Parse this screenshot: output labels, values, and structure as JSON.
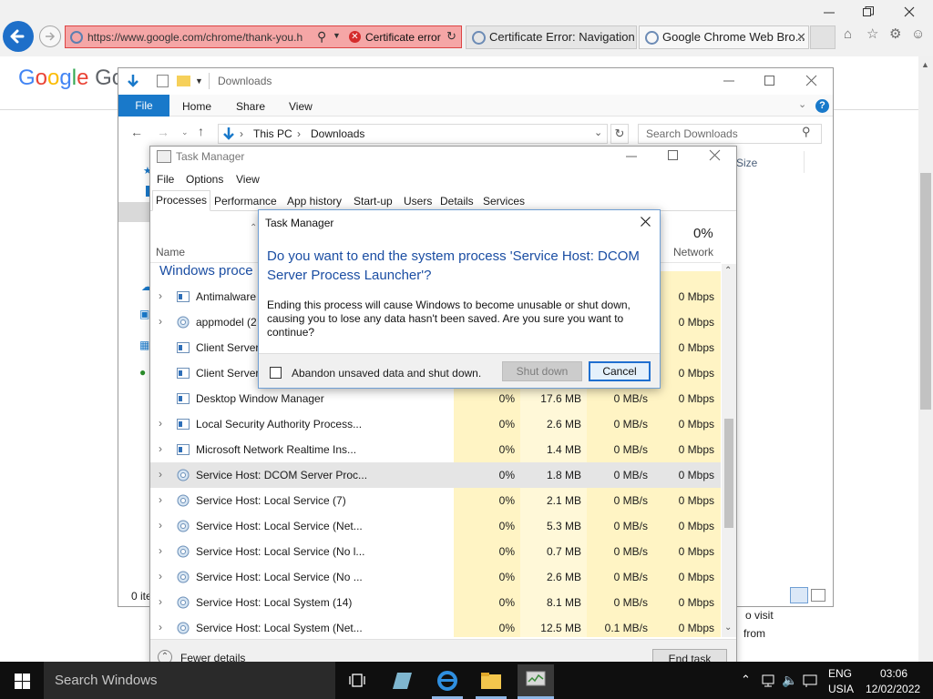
{
  "browser": {
    "address_url": "https://www.google.com/chrome/thank-you.h",
    "cert_error": "Certificate error",
    "tabs": [
      {
        "label": "Certificate Error: Navigation ..."
      },
      {
        "label": "Google Chrome Web Bro..."
      }
    ]
  },
  "page": {
    "logo_text": "Google Ch",
    "side_text_1": "o visit",
    "side_text_2": "from"
  },
  "explorer": {
    "title": "Downloads",
    "ribbon": {
      "file": "File",
      "home": "Home",
      "share": "Share",
      "view": "View"
    },
    "breadcrumb": {
      "root": "This PC",
      "current": "Downloads"
    },
    "search_placeholder": "Search Downloads",
    "size_header": "Size",
    "status": "0 ite"
  },
  "task_manager": {
    "title": "Task Manager",
    "menu": {
      "file": "File",
      "options": "Options",
      "view": "View"
    },
    "tabs": [
      "Processes",
      "Performance",
      "App history",
      "Start-up",
      "Users",
      "Details",
      "Services"
    ],
    "name_header": "Name",
    "network_percent": "0%",
    "network_header": "Network",
    "group_header": "Windows proce",
    "rows": [
      {
        "name": "Antimalware",
        "cpu": "",
        "mem": "",
        "disk": "",
        "net": "0 Mbps",
        "expand": true,
        "icon": "app"
      },
      {
        "name": "appmodel (2",
        "cpu": "",
        "mem": "",
        "disk": "",
        "net": "0 Mbps",
        "expand": true,
        "icon": "gear"
      },
      {
        "name": "Client Server",
        "cpu": "",
        "mem": "",
        "disk": "",
        "net": "0 Mbps",
        "expand": false,
        "icon": "app"
      },
      {
        "name": "Client Server",
        "cpu": "",
        "mem": "",
        "disk": "",
        "net": "0 Mbps",
        "expand": false,
        "icon": "app"
      },
      {
        "name": "Desktop Window Manager",
        "cpu": "0%",
        "mem": "17.6 MB",
        "disk": "0 MB/s",
        "net": "0 Mbps",
        "expand": false,
        "icon": "app"
      },
      {
        "name": "Local Security Authority Process...",
        "cpu": "0%",
        "mem": "2.6 MB",
        "disk": "0 MB/s",
        "net": "0 Mbps",
        "expand": true,
        "icon": "app"
      },
      {
        "name": "Microsoft Network Realtime Ins...",
        "cpu": "0%",
        "mem": "1.4 MB",
        "disk": "0 MB/s",
        "net": "0 Mbps",
        "expand": true,
        "icon": "app"
      },
      {
        "name": "Service Host: DCOM Server Proc...",
        "cpu": "0%",
        "mem": "1.8 MB",
        "disk": "0 MB/s",
        "net": "0 Mbps",
        "expand": true,
        "icon": "gear",
        "selected": true
      },
      {
        "name": "Service Host: Local Service (7)",
        "cpu": "0%",
        "mem": "2.1 MB",
        "disk": "0 MB/s",
        "net": "0 Mbps",
        "expand": true,
        "icon": "gear"
      },
      {
        "name": "Service Host: Local Service (Net...",
        "cpu": "0%",
        "mem": "5.3 MB",
        "disk": "0 MB/s",
        "net": "0 Mbps",
        "expand": true,
        "icon": "gear"
      },
      {
        "name": "Service Host: Local Service (No l...",
        "cpu": "0%",
        "mem": "0.7 MB",
        "disk": "0 MB/s",
        "net": "0 Mbps",
        "expand": true,
        "icon": "gear"
      },
      {
        "name": "Service Host: Local Service (No ...",
        "cpu": "0%",
        "mem": "2.6 MB",
        "disk": "0 MB/s",
        "net": "0 Mbps",
        "expand": true,
        "icon": "gear"
      },
      {
        "name": "Service Host: Local System (14)",
        "cpu": "0%",
        "mem": "8.1 MB",
        "disk": "0 MB/s",
        "net": "0 Mbps",
        "expand": true,
        "icon": "gear"
      },
      {
        "name": "Service Host: Local System (Net...",
        "cpu": "0%",
        "mem": "12.5 MB",
        "disk": "0.1 MB/s",
        "net": "0 Mbps",
        "expand": true,
        "icon": "gear"
      }
    ],
    "fewer_details": "Fewer details",
    "end_task": "End task"
  },
  "dialog": {
    "title": "Task Manager",
    "heading": "Do you want to end the system process 'Service Host: DCOM Server Process Launcher'?",
    "body": "Ending this process will cause Windows to become unusable or shut down, causing you to lose any data hasn't been saved. Are you sure you want to continue?",
    "checkbox_label": "Abandon unsaved data and shut down.",
    "checkbox_checked": false,
    "shutdown_label": "Shut down",
    "cancel_label": "Cancel"
  },
  "taskbar": {
    "search_placeholder": "Search Windows",
    "lang_1": "ENG",
    "lang_2": "USIA",
    "time": "03:06",
    "date": "12/02/2022"
  },
  "colors": {
    "accent": "#1979ca",
    "dialog_heading": "#1b4ea3",
    "usage_column": "#fff4c4",
    "selected_row": "#e5e5e5",
    "cert_error_bg": "#f5a6a6"
  }
}
